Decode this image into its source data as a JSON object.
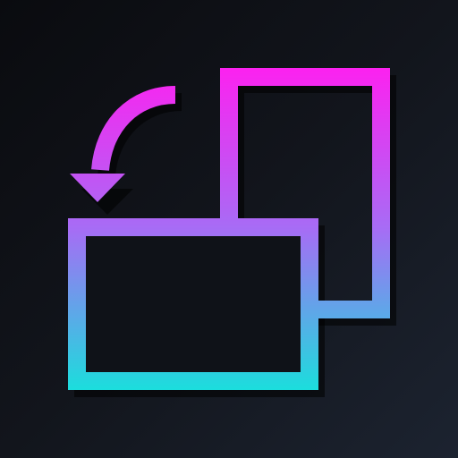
{
  "icon": {
    "name": "rotate-orientation",
    "elements": [
      "rotate-arrow-icon",
      "portrait-frame-icon",
      "landscape-frame-icon"
    ]
  },
  "colors": {
    "background_dark": "#0a0b0f",
    "background_light": "#1c2330",
    "gradient_top": "#ff1ff0",
    "gradient_mid": "#a76cf5",
    "gradient_bottom": "#18e0dc",
    "shadow": "#000000"
  }
}
